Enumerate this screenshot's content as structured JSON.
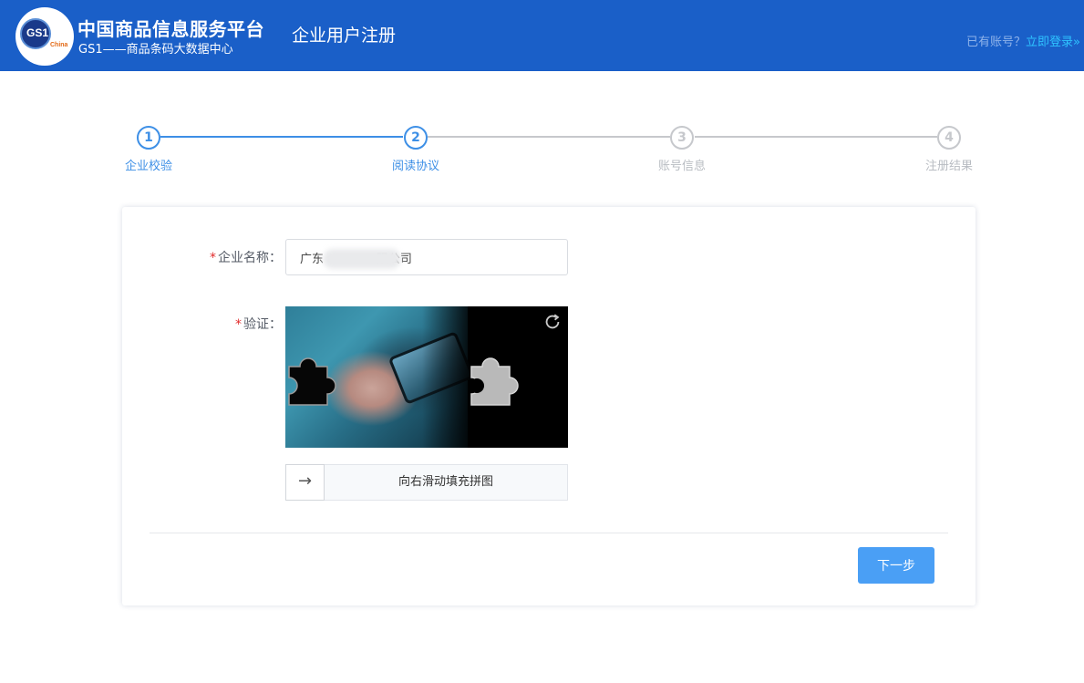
{
  "header": {
    "logo_text": "GS1",
    "logo_sub": "China",
    "brand_title": "中国商品信息服务平台",
    "brand_subtitle": "GS1——商品条码大数据中心",
    "page_heading": "企业用户注册",
    "login_question": "已有账号？",
    "login_link": "立即登录»"
  },
  "steps": [
    {
      "number": "1",
      "label": "企业校验",
      "active": true
    },
    {
      "number": "2",
      "label": "阅读协议",
      "active": true
    },
    {
      "number": "3",
      "label": "账号信息",
      "active": false
    },
    {
      "number": "4",
      "label": "注册结果",
      "active": false
    }
  ],
  "colors": {
    "header_bg": "#1a5fc8",
    "step_active": "#3d8fe6",
    "step_inactive": "#c6c8cc",
    "button_bg": "#4a9ff5",
    "required": "#e12b2b"
  },
  "form": {
    "required_mark": "*",
    "company_label": "企业名称：",
    "company_value": "广东              限公司",
    "captcha_label": "验证：",
    "captcha_image": "puzzle-photo-hand-holding-phone",
    "refresh_icon": "refresh-icon",
    "slider_arrow": "→",
    "slider_text": "向右滑动填充拼图",
    "next_label": "下一步"
  }
}
